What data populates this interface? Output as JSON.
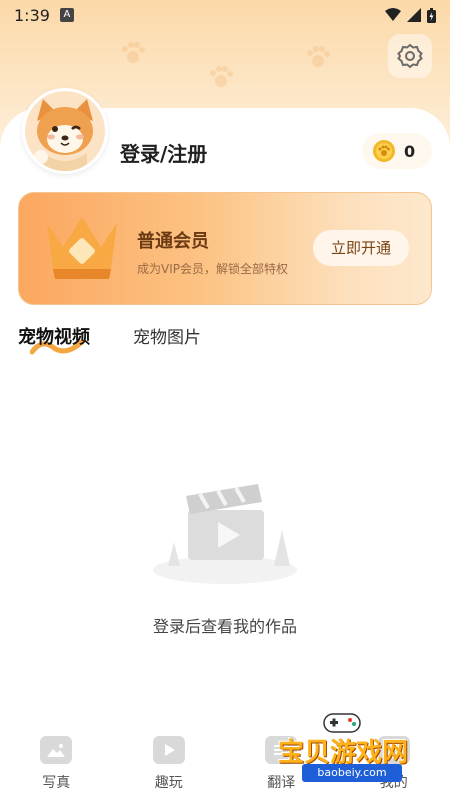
{
  "status_bar": {
    "time": "1:39",
    "indicator": "A"
  },
  "profile": {
    "login_label": "登录/注册",
    "coins": "0"
  },
  "vip": {
    "title": "普通会员",
    "subtitle": "成为VIP会员，解锁全部特权",
    "button": "立即开通"
  },
  "tabs": [
    {
      "label": "宠物视频",
      "active": true
    },
    {
      "label": "宠物图片",
      "active": false
    }
  ],
  "empty_state": {
    "message": "登录后查看我的作品"
  },
  "bottom_nav": [
    {
      "label": "写真",
      "icon": "image-icon"
    },
    {
      "label": "趣玩",
      "icon": "video-play-icon"
    },
    {
      "label": "翻译",
      "icon": "translate-icon"
    },
    {
      "label": "我的",
      "icon": "profile-icon"
    }
  ],
  "watermark": {
    "text": "宝贝游戏网",
    "url": "baobeiy.com"
  },
  "colors": {
    "accent": "#fba75f",
    "header": "#fbd9a8",
    "text_dark": "#1f1f1f"
  }
}
